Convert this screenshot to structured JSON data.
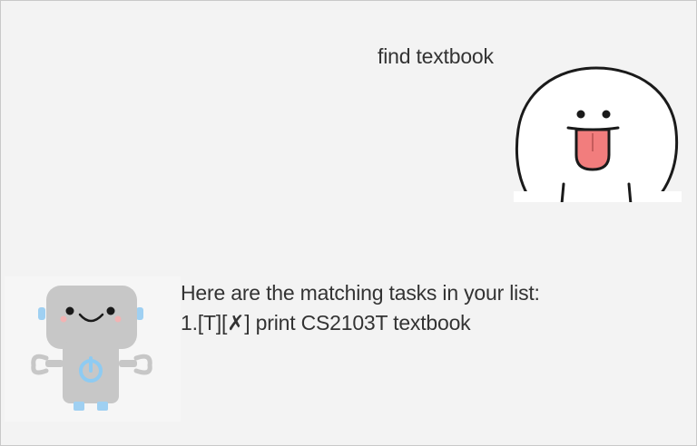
{
  "conversation": {
    "user_message": "find textbook",
    "bot_response": {
      "intro": "Here are the matching tasks in your list:",
      "tasks": [
        "1.[T][✗] print CS2103T textbook"
      ]
    }
  },
  "avatars": {
    "user": "smiling-blob-tongue-out-icon",
    "bot": "robot-power-icon"
  }
}
